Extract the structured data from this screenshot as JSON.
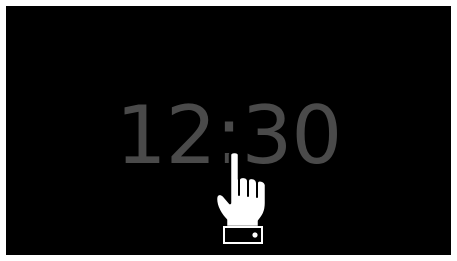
{
  "clock": {
    "time": "12:30"
  },
  "colors": {
    "frame": "#ffffff",
    "screen": "#000000",
    "clock_text": "#4a4a4a"
  },
  "cursor": {
    "icon": "pointing-hand-cursor-icon"
  }
}
